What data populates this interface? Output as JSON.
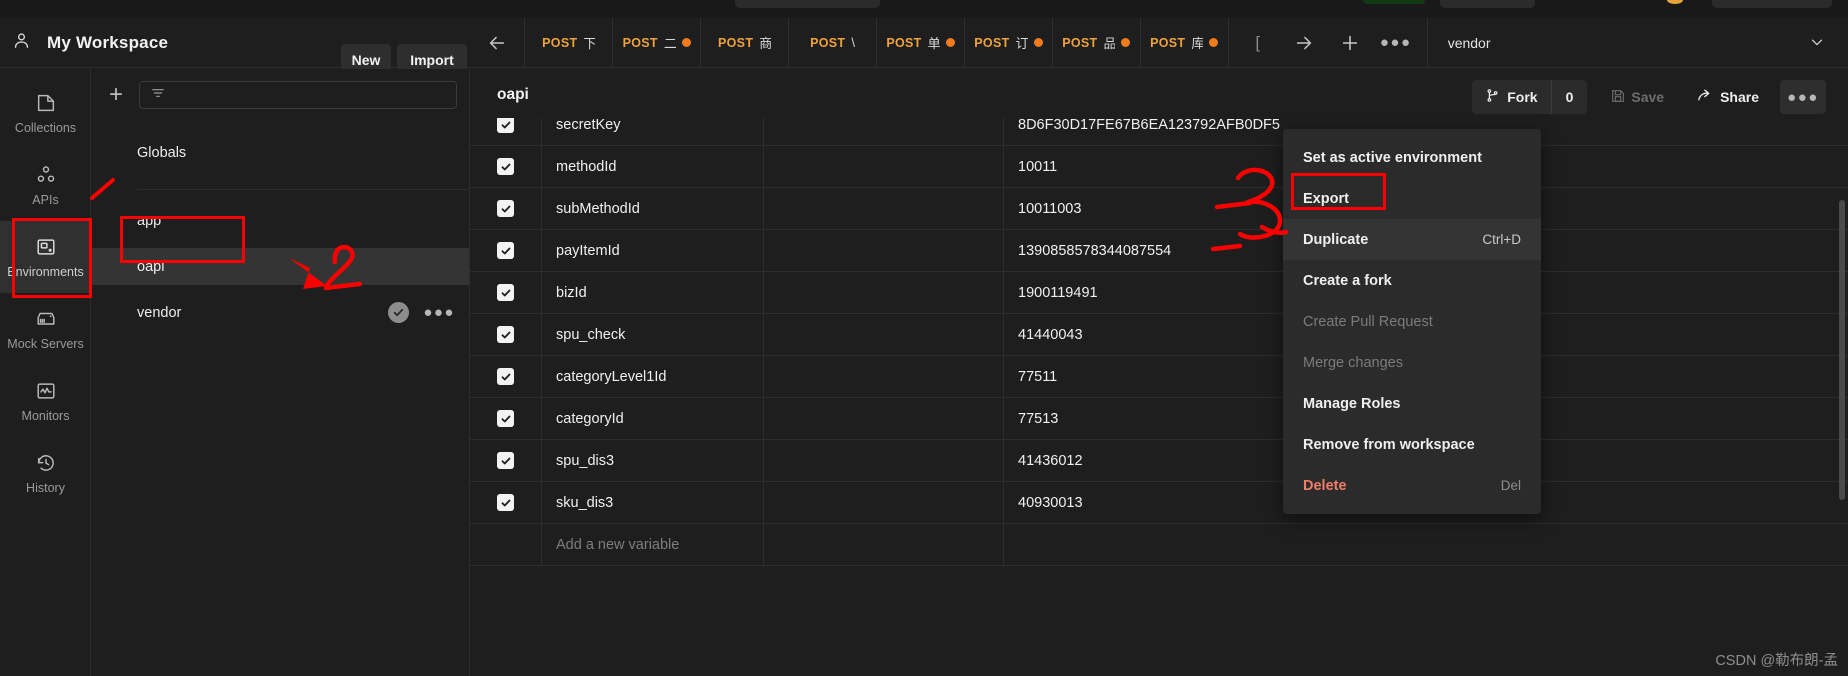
{
  "workspace": {
    "title": "My Workspace",
    "user_icon": "user-avatar-icon",
    "new_label": "New",
    "import_label": "Import"
  },
  "rail": {
    "items": [
      {
        "label": "Collections",
        "icon": "collections-icon",
        "active": false
      },
      {
        "label": "APIs",
        "icon": "apis-icon",
        "active": false
      },
      {
        "label": "Environments",
        "icon": "environments-icon",
        "active": true
      },
      {
        "label": "Mock Servers",
        "icon": "mock-servers-icon",
        "active": false
      },
      {
        "label": "Monitors",
        "icon": "monitors-icon",
        "active": false
      },
      {
        "label": "History",
        "icon": "history-icon",
        "active": false
      }
    ]
  },
  "env_panel": {
    "add_icon": "plus-icon",
    "filter_icon": "filter-icon",
    "globals_label": "Globals",
    "environments": [
      {
        "label": "app",
        "selected": false,
        "active": false
      },
      {
        "label": "oapi",
        "selected": true,
        "active": false
      },
      {
        "label": "vendor",
        "selected": false,
        "active": true
      }
    ],
    "active_check_icon": "check-circle-icon",
    "row_more_icon": "ellipsis-icon"
  },
  "tabbar": {
    "back_icon": "arrow-left-icon",
    "tabs": [
      {
        "method": "POST",
        "name": "下",
        "dirty": false,
        "active": false
      },
      {
        "method": "POST",
        "name": "二",
        "dirty": true,
        "active": false
      },
      {
        "method": "POST",
        "name": "商",
        "dirty": false,
        "active": false
      },
      {
        "method": "POST",
        "name": "\\",
        "dirty": false,
        "active": false
      },
      {
        "method": "POST",
        "name": "单",
        "dirty": true,
        "active": false
      },
      {
        "method": "POST",
        "name": "订",
        "dirty": true,
        "active": false
      },
      {
        "method": "POST",
        "name": "品",
        "dirty": true,
        "active": false
      },
      {
        "method": "POST",
        "name": "库",
        "dirty": true,
        "active": false
      }
    ],
    "actions": [
      {
        "icon": "arrow-right-icon",
        "name": "forward-button"
      },
      {
        "icon": "plus-icon",
        "name": "new-tab-button"
      },
      {
        "icon": "ellipsis-icon",
        "name": "tab-more-button"
      }
    ],
    "env_selector": {
      "value": "vendor",
      "chevron_icon": "chevron-down-icon"
    }
  },
  "env_detail": {
    "name": "oapi",
    "fork_label": "Fork",
    "fork_icon": "fork-icon",
    "fork_count": "0",
    "save_label": "Save",
    "save_icon": "save-icon",
    "share_label": "Share",
    "share_icon": "share-icon",
    "more_icon": "ellipsis-icon"
  },
  "variables": {
    "new_row_placeholder": "Add a new variable",
    "rows": [
      {
        "enabled": true,
        "name": "secretKey",
        "type": "",
        "value": "8D6F30D17FE67B6EA123792AFB0DF5"
      },
      {
        "enabled": true,
        "name": "methodId",
        "type": "",
        "value": "10011"
      },
      {
        "enabled": true,
        "name": "subMethodId",
        "type": "",
        "value": "10011003"
      },
      {
        "enabled": true,
        "name": "payItemId",
        "type": "",
        "value": "1390858578344087554"
      },
      {
        "enabled": true,
        "name": "bizId",
        "type": "",
        "value": "1900119491"
      },
      {
        "enabled": true,
        "name": "spu_check",
        "type": "",
        "value": "41440043"
      },
      {
        "enabled": true,
        "name": "categoryLevel1Id",
        "type": "",
        "value": "77511"
      },
      {
        "enabled": true,
        "name": "categoryId",
        "type": "",
        "value": "77513"
      },
      {
        "enabled": true,
        "name": "spu_dis3",
        "type": "",
        "value": "41436012"
      },
      {
        "enabled": true,
        "name": "sku_dis3",
        "type": "",
        "value": "40930013"
      }
    ]
  },
  "context_menu": {
    "items": [
      {
        "label": "Set as active environment",
        "shortcut": "",
        "state": "normal"
      },
      {
        "label": "Export",
        "shortcut": "",
        "state": "normal"
      },
      {
        "label": "Duplicate",
        "shortcut": "Ctrl+D",
        "state": "highlighted"
      },
      {
        "label": "Create a fork",
        "shortcut": "",
        "state": "normal"
      },
      {
        "label": "Create Pull Request",
        "shortcut": "",
        "state": "disabled"
      },
      {
        "label": "Merge changes",
        "shortcut": "",
        "state": "disabled"
      },
      {
        "label": "Manage Roles",
        "shortcut": "",
        "state": "normal"
      },
      {
        "label": "Remove from workspace",
        "shortcut": "",
        "state": "normal"
      },
      {
        "label": "Delete",
        "shortcut": "Del",
        "state": "danger"
      }
    ]
  },
  "annotations": {
    "color": "#fb0000",
    "marks": [
      {
        "kind": "box",
        "target": "environments-rail-item"
      },
      {
        "kind": "box",
        "target": "env-row-oapi"
      },
      {
        "kind": "box",
        "target": "menu-item-export"
      },
      {
        "kind": "slash",
        "target": "step-1-pointer"
      },
      {
        "kind": "digit",
        "text": "2",
        "target": "env-row-oapi"
      },
      {
        "kind": "digit",
        "text": "3",
        "target": "menu-item-export"
      }
    ]
  },
  "watermark": {
    "text": "CSDN @勒布朗-孟"
  }
}
